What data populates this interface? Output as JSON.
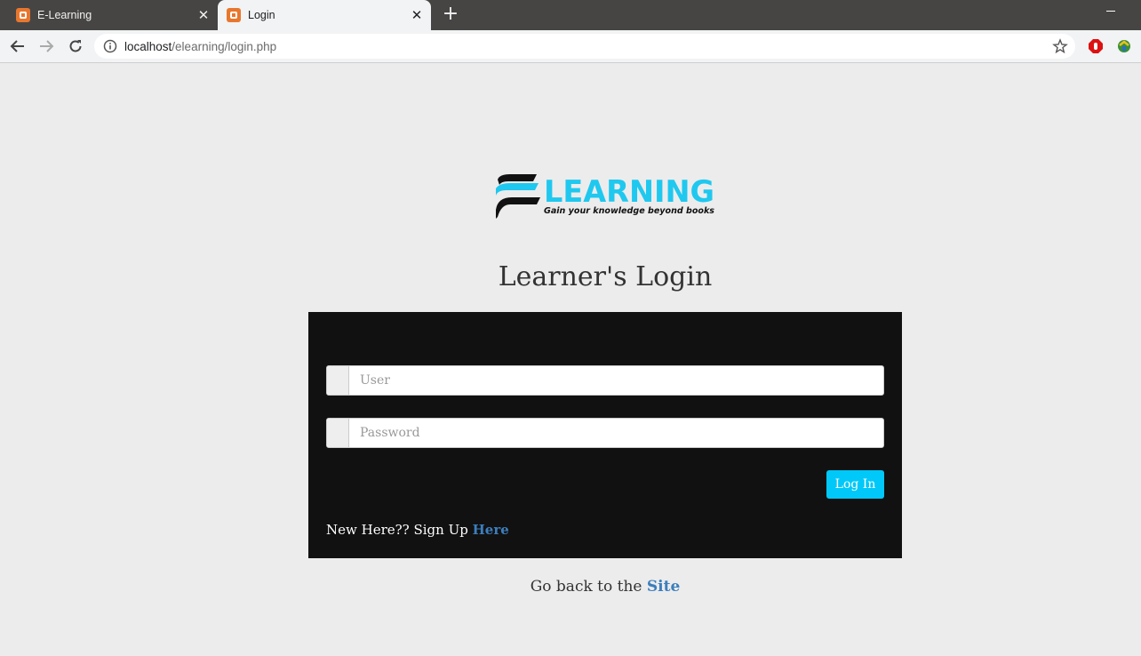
{
  "browser": {
    "tabs": [
      {
        "title": "E-Learning",
        "active": false
      },
      {
        "title": "Login",
        "active": true
      }
    ],
    "url_host": "localhost",
    "url_path": "/elearning/login.php"
  },
  "logo": {
    "wordmark": "LEARNING",
    "tagline": "Gain your knowledge beyond books"
  },
  "page": {
    "heading": "Learner's Login",
    "user_placeholder": "User",
    "password_placeholder": "Password",
    "login_label": "Log In",
    "signup_prefix": "New Here?? Sign Up",
    "signup_link": "Here",
    "goback_prefix": "Go back to the",
    "goback_link": "Site"
  },
  "colors": {
    "accent": "#00c8f8",
    "link": "#3c7ebd",
    "panel": "#111111",
    "background": "#ececec"
  }
}
